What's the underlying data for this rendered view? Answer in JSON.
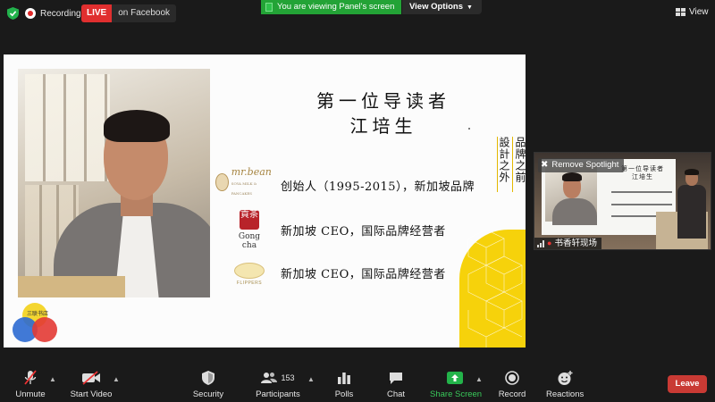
{
  "top_bar": {
    "recording_label": "Recording",
    "live_badge": "LIVE",
    "live_target": "on Facebook",
    "viewing_banner": "You are viewing Panel's screen",
    "view_options_label": "View Options",
    "view_button_label": "View"
  },
  "slide": {
    "title_line1": "第一位导读者",
    "title_line2": "江培生",
    "vertical_col1": "品牌之前",
    "vertical_col2": "設計之外",
    "rows": [
      {
        "logo_name": "mr.bean",
        "logo_sub": "SOYA MILK & PANCAKES",
        "text": "创始人（1995-2015），新加坡品牌"
      },
      {
        "logo_name": "Gong cha",
        "logo_seal": "貢茶",
        "text": "新加坡 CEO，国际品牌经营者"
      },
      {
        "logo_name": "FLIPPERS",
        "text": "新加坡 CEO，国际品牌经营者"
      }
    ],
    "brand_mark_text": "三联书店"
  },
  "spotlight": {
    "remove_label": "Remove Spotlight",
    "participant_name": "书香轩现场",
    "mini_title1": "第一位导读者",
    "mini_title2": "江培生"
  },
  "toolbar": {
    "unmute": "Unmute",
    "start_video": "Start Video",
    "security": "Security",
    "participants": "Participants",
    "participants_count": "153",
    "polls": "Polls",
    "chat": "Chat",
    "share_screen": "Share Screen",
    "record": "Record",
    "reactions": "Reactions",
    "leave": "Leave"
  },
  "colors": {
    "live_red": "#e02f2f",
    "viewing_green": "#23a336",
    "share_green": "#23b34a",
    "leave_red": "#c93a34",
    "accent_yellow": "#f6d20b"
  }
}
